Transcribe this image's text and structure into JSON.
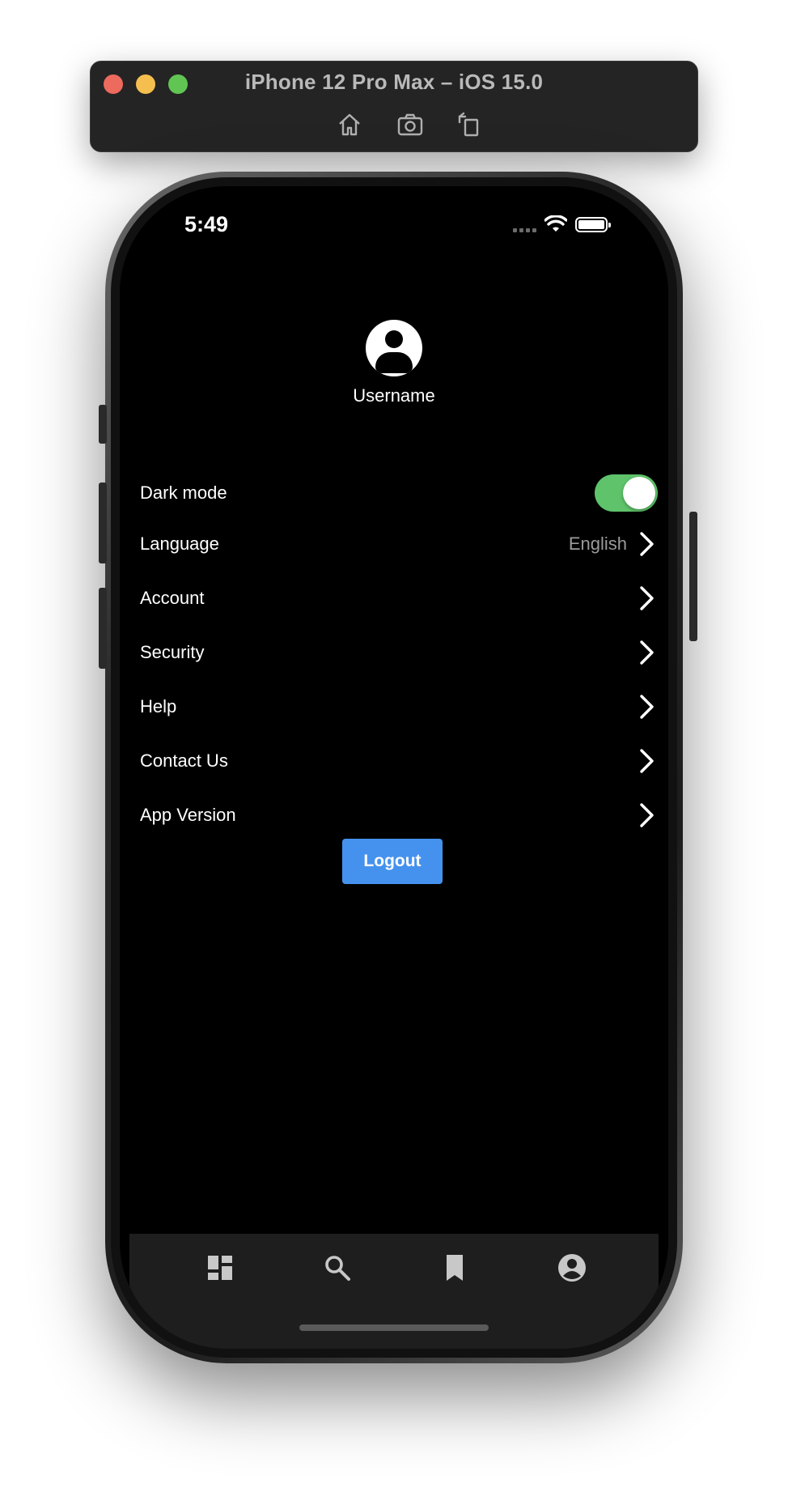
{
  "simulator": {
    "title": "iPhone 12 Pro Max – iOS 15.0",
    "toolbar": [
      "home-icon",
      "screenshot-icon",
      "rotate-icon"
    ]
  },
  "status_bar": {
    "time": "5:49"
  },
  "profile": {
    "username": "Username"
  },
  "settings": {
    "dark_mode_label": "Dark mode",
    "dark_mode_on": true,
    "language_label": "Language",
    "language_value": "English",
    "account_label": "Account",
    "security_label": "Security",
    "help_label": "Help",
    "contact_label": "Contact Us",
    "version_label": "App Version"
  },
  "logout_label": "Logout",
  "tabbar": {
    "tabs": [
      "dashboard-icon",
      "search-icon",
      "bookmark-icon",
      "account-circle-icon"
    ]
  },
  "colors": {
    "toggle_on": "#5ec36a",
    "logout_button": "#4592ee",
    "tabbar_bg": "#1e1e1e"
  }
}
